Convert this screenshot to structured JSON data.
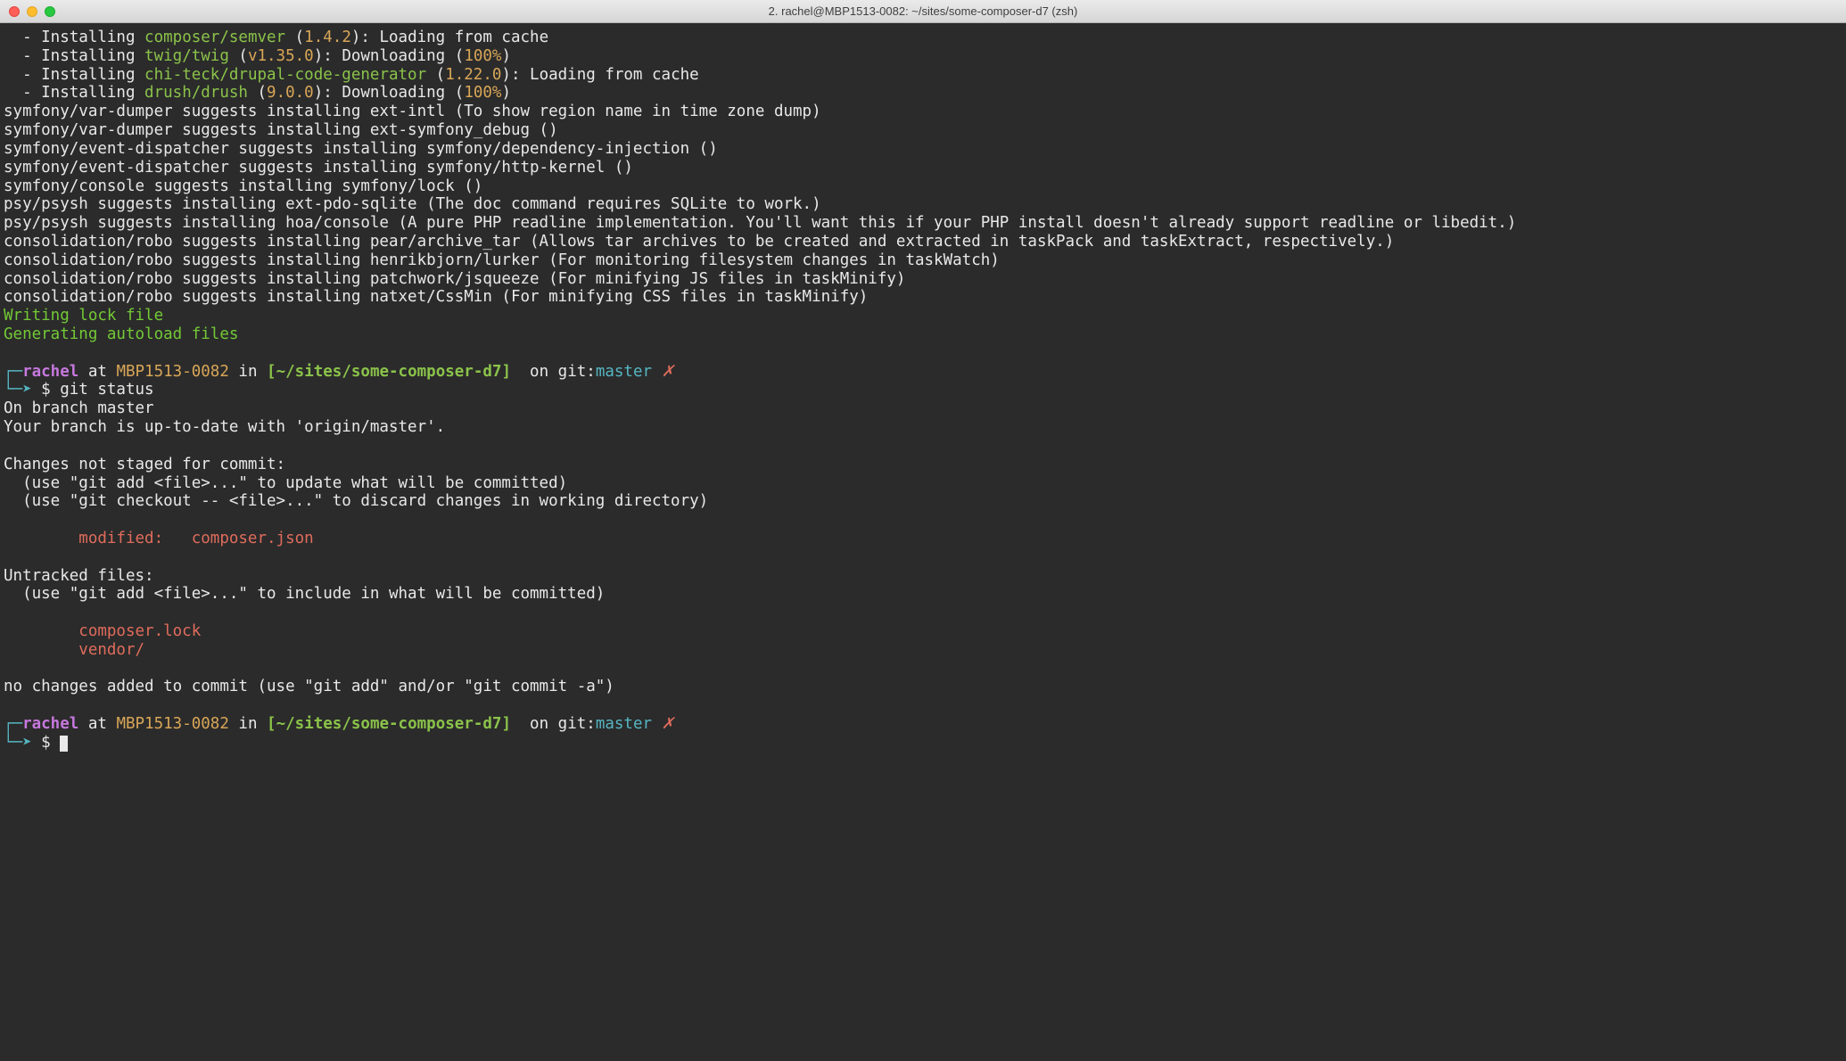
{
  "window": {
    "title": "2. rachel@MBP1513-0082: ~/sites/some-composer-d7 (zsh)"
  },
  "install": [
    {
      "pkg": "composer/semver",
      "ver": "1.4.2",
      "msg": "Loading from cache",
      "pct": ""
    },
    {
      "pkg": "twig/twig",
      "ver": "v1.35.0",
      "msg": "Downloading",
      "pct": "100%"
    },
    {
      "pkg": "chi-teck/drupal-code-generator",
      "ver": "1.22.0",
      "msg": "Loading from cache",
      "pct": ""
    },
    {
      "pkg": "drush/drush",
      "ver": "9.0.0",
      "msg": "Downloading",
      "pct": "100%"
    }
  ],
  "suggests": [
    "symfony/var-dumper suggests installing ext-intl (To show region name in time zone dump)",
    "symfony/var-dumper suggests installing ext-symfony_debug ()",
    "symfony/event-dispatcher suggests installing symfony/dependency-injection ()",
    "symfony/event-dispatcher suggests installing symfony/http-kernel ()",
    "symfony/console suggests installing symfony/lock ()",
    "psy/psysh suggests installing ext-pdo-sqlite (The doc command requires SQLite to work.)",
    "psy/psysh suggests installing hoa/console (A pure PHP readline implementation. You'll want this if your PHP install doesn't already support readline or libedit.)",
    "consolidation/robo suggests installing pear/archive_tar (Allows tar archives to be created and extracted in taskPack and taskExtract, respectively.)",
    "consolidation/robo suggests installing henrikbjorn/lurker (For monitoring filesystem changes in taskWatch)",
    "consolidation/robo suggests installing patchwork/jsqueeze (For minifying JS files in taskMinify)",
    "consolidation/robo suggests installing natxet/CssMin (For minifying CSS files in taskMinify)"
  ],
  "writing": "Writing lock file",
  "generating": "Generating autoload files",
  "prompt": {
    "user": "rachel",
    "at": " at ",
    "host": "MBP1513-0082",
    "in": " in ",
    "path": "[~/sites/some-composer-d7]",
    "ongit": "  on git:",
    "branch": "master",
    "dirty": " ✗",
    "arrow": "└─➤",
    "top": "┌─",
    "dollar": " $ "
  },
  "cmd1": "git status",
  "git": {
    "l1": "On branch master",
    "l2": "Your branch is up-to-date with 'origin/master'.",
    "l3": "Changes not staged for commit:",
    "l4": "  (use \"git add <file>...\" to update what will be committed)",
    "l5": "  (use \"git checkout -- <file>...\" to discard changes in working directory)",
    "mod": "        modified:   composer.json",
    "l6": "Untracked files:",
    "l7": "  (use \"git add <file>...\" to include in what will be committed)",
    "u1": "        composer.lock",
    "u2": "        vendor/",
    "l8": "no changes added to commit (use \"git add\" and/or \"git commit -a\")"
  },
  "installPrefix": "  - Installing "
}
